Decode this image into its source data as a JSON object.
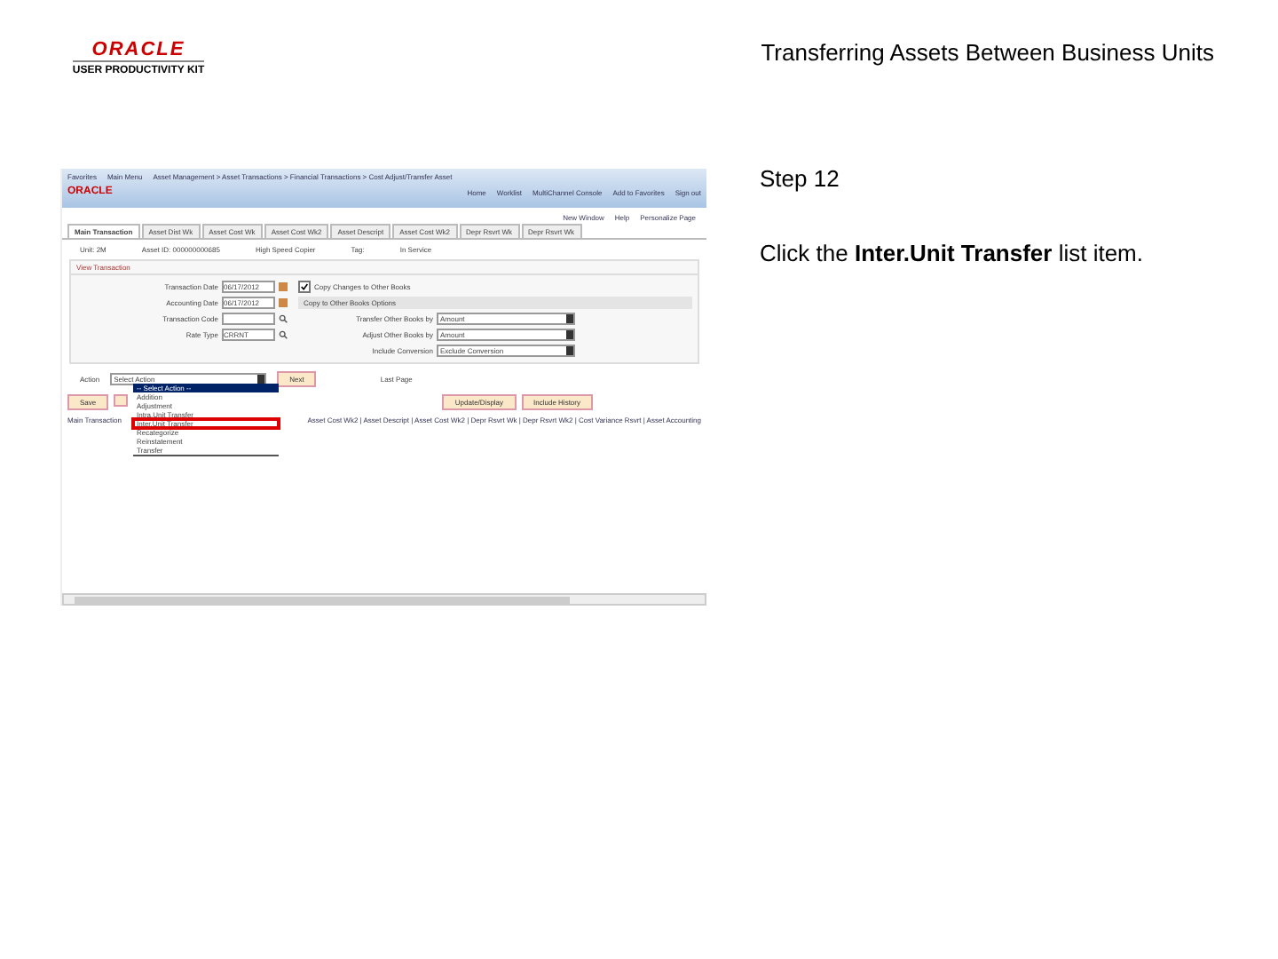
{
  "header": {
    "logo_text": "ORACLE",
    "logo_subtitle": "USER PRODUCTIVITY KIT",
    "title": "Transferring Assets Between Business Units"
  },
  "screenshot": {
    "nav": [
      "Favorites",
      "Main Menu"
    ],
    "breadcrumb": "Asset Management > Asset Transactions > Financial Transactions > Cost Adjust/Transfer Asset",
    "brand": "ORACLE",
    "top_links": [
      "Home",
      "Worklist",
      "MultiChannel Console",
      "Add to Favorites",
      "Sign out"
    ],
    "page_links": [
      "New Window",
      "Help",
      "Personalize Page"
    ],
    "tabs": [
      {
        "label": "Main Transaction",
        "selected": true
      },
      {
        "label": "Asset Dist Wk",
        "selected": false
      },
      {
        "label": "Asset Cost Wk",
        "selected": false
      },
      {
        "label": "Asset Cost Wk2",
        "selected": false
      },
      {
        "label": "Asset Descript",
        "selected": false
      },
      {
        "label": "Asset Cost Wk2",
        "selected": false
      },
      {
        "label": "Depr Rsvrt Wk",
        "selected": false
      },
      {
        "label": "Depr Rsvrt Wk",
        "selected": false
      }
    ],
    "info": [
      "Unit: 2M",
      "Asset ID: 000000000685",
      "High Speed Copier",
      "Tag:",
      "In Service"
    ],
    "panel_title": "View Transaction",
    "fields": [
      {
        "label": "Transaction Date",
        "value": "06/17/2012",
        "kind": "date"
      },
      {
        "label": "Accounting Date",
        "value": "06/17/2012",
        "kind": "date"
      },
      {
        "label": "Transaction Code",
        "kind": "lookup"
      },
      {
        "label": "Rate Type",
        "value": "CRRNT",
        "kind": "lookup"
      }
    ],
    "copy_checkbox": {
      "label": "Copy Changes to Other Books",
      "checked": true
    },
    "options_title": "Copy to Other Books Options",
    "selects": [
      {
        "label": "Transfer Other Books by",
        "value": "Amount"
      },
      {
        "label": "Adjust Other Books by",
        "value": "Amount"
      },
      {
        "label": "Include Conversion",
        "value": "Exclude Conversion"
      }
    ],
    "action": {
      "label": "Action",
      "value": "Select Action"
    },
    "next_button": "Next",
    "last_page": "Last Page",
    "dropdown": [
      {
        "label": "-- Select Action --",
        "selected": true,
        "highlighted": false
      },
      {
        "label": "Addition",
        "selected": false,
        "highlighted": false
      },
      {
        "label": "Adjustment",
        "selected": false,
        "highlighted": false
      },
      {
        "label": "Intra.Unit Transfer",
        "selected": false,
        "highlighted": false
      },
      {
        "label": "Inter.Unit Transfer",
        "selected": false,
        "highlighted": true
      },
      {
        "label": "Recategorize",
        "selected": false,
        "highlighted": false
      },
      {
        "label": "Reinstatement",
        "selected": false,
        "highlighted": false
      },
      {
        "label": "Transfer",
        "selected": false,
        "highlighted": false
      }
    ],
    "left_buttons": [
      "Save"
    ],
    "right_buttons": [
      "Update/Display",
      "Include History"
    ],
    "bottom_left": "Main Transaction",
    "bottom_links": "Asset Cost Wk2 | Asset Descript | Asset Cost Wk2 | Depr Rsvrt Wk | Depr Rsvrt Wk2 | Cost Variance Rsvrt | Asset Accounting"
  },
  "step": {
    "title": "Step 12",
    "instruction": "Click the **Inter.Unit Transfer** list item."
  }
}
